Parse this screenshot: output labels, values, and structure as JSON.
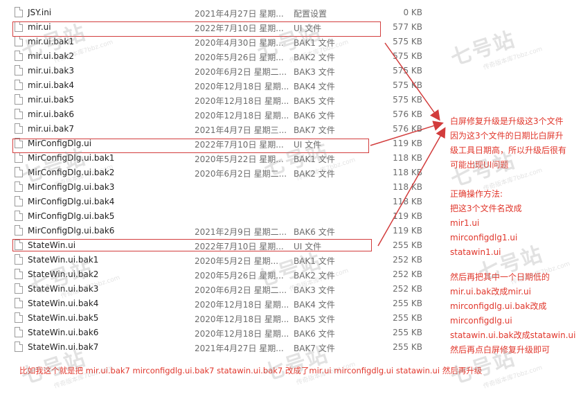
{
  "files": [
    {
      "name": "JSY.ini",
      "date": "2021年4月27日 星期...",
      "type": "配置设置",
      "size": "0 KB"
    },
    {
      "name": "mir.ui",
      "date": "2022年7月10日 星期...",
      "type": "UI 文件",
      "size": "577 KB"
    },
    {
      "name": "mir.ui.bak1",
      "date": "2020年4月30日 星期...",
      "type": "BAK1 文件",
      "size": "575 KB"
    },
    {
      "name": "mir.ui.bak2",
      "date": "2020年5月26日 星期...",
      "type": "BAK2 文件",
      "size": "575 KB"
    },
    {
      "name": "mir.ui.bak3",
      "date": "2020年6月2日 星期二...",
      "type": "BAK3 文件",
      "size": "575 KB"
    },
    {
      "name": "mir.ui.bak4",
      "date": "2020年12月18日 星期...",
      "type": "BAK4 文件",
      "size": "575 KB"
    },
    {
      "name": "mir.ui.bak5",
      "date": "2020年12月18日 星期...",
      "type": "BAK5 文件",
      "size": "575 KB"
    },
    {
      "name": "mir.ui.bak6",
      "date": "2020年12月18日 星期...",
      "type": "BAK6 文件",
      "size": "576 KB"
    },
    {
      "name": "mir.ui.bak7",
      "date": "2021年4月7日 星期三...",
      "type": "BAK7 文件",
      "size": "576 KB"
    },
    {
      "name": "MirConfigDlg.ui",
      "date": "2022年7月10日 星期...",
      "type": "UI 文件",
      "size": "119 KB"
    },
    {
      "name": "MirConfigDlg.ui.bak1",
      "date": "2020年5月22日 星期...",
      "type": "BAK1 文件",
      "size": "118 KB"
    },
    {
      "name": "MirConfigDlg.ui.bak2",
      "date": "2020年6月2日 星期二...",
      "type": "BAK2 文件",
      "size": "118 KB"
    },
    {
      "name": "MirConfigDlg.ui.bak3",
      "date": "",
      "type": "",
      "size": "118 KB"
    },
    {
      "name": "MirConfigDlg.ui.bak4",
      "date": "",
      "type": "",
      "size": "118 KB"
    },
    {
      "name": "MirConfigDlg.ui.bak5",
      "date": "",
      "type": "",
      "size": "119 KB"
    },
    {
      "name": "MirConfigDlg.ui.bak6",
      "date": "2021年2月9日 星期二...",
      "type": "BAK6 文件",
      "size": "119 KB"
    },
    {
      "name": "StateWin.ui",
      "date": "2022年7月10日 星期...",
      "type": "UI 文件",
      "size": "255 KB"
    },
    {
      "name": "StateWin.ui.bak1",
      "date": "2020年5月2日 星期...",
      "type": "BAK1 文件",
      "size": "252 KB"
    },
    {
      "name": "StateWin.ui.bak2",
      "date": "2020年5月26日 星期...",
      "type": "BAK2 文件",
      "size": "252 KB"
    },
    {
      "name": "StateWin.ui.bak3",
      "date": "2020年6月2日 星期二...",
      "type": "BAK3 文件",
      "size": "252 KB"
    },
    {
      "name": "StateWin.ui.bak4",
      "date": "2020年12月18日 星期...",
      "type": "BAK4 文件",
      "size": "255 KB"
    },
    {
      "name": "StateWin.ui.bak5",
      "date": "2020年12月18日 星期...",
      "type": "BAK5 文件",
      "size": "255 KB"
    },
    {
      "name": "StateWin.ui.bak6",
      "date": "2020年12月18日 星期...",
      "type": "BAK6 文件",
      "size": "255 KB"
    },
    {
      "name": "StateWin.ui.bak7",
      "date": "2021年4月27日 星期...",
      "type": "BAK7 文件",
      "size": "255 KB"
    }
  ],
  "notes": {
    "explanation": [
      "白屏修复升级是升级这3个文件",
      "因为这3个文件的日期比白屏升",
      "级工具日期高，所以升级后很有",
      "可能出现UI问题"
    ],
    "steps": [
      "正确操作方法:",
      "把这3个文件名改成",
      "mir1.ui",
      "mirconfigdlg1.ui",
      "statawin1.ui"
    ],
    "then": [
      "然后再把其中一个日期低的",
      "mir.ui.bak改成mir.ui",
      "mirconfigdlg.ui.bak改成",
      "mirconfigdlg.ui",
      "statawin.ui.bak改成statawin.ui",
      "然后再点白屏修复升级即可"
    ],
    "bottom": "比如我这个就是把 mir.ui.bak7   mirconfigdlg.ui.bak7   statawin.ui.bak7   改成了mir.ui   mirconfigdlg.ui   statawin.ui 然后再升级"
  },
  "watermark": {
    "text": "七号站",
    "sub": "传奇版本库7bbz.com"
  },
  "colors": {
    "annotation": "#e0362b",
    "highlight": "#d23c3c"
  }
}
